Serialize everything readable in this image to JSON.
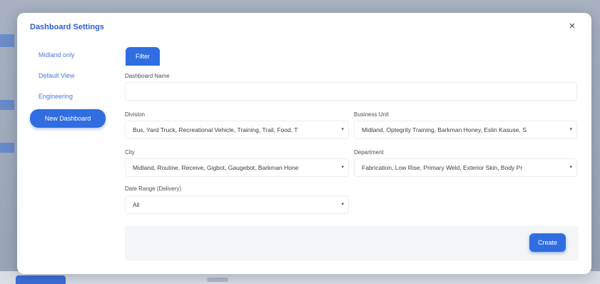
{
  "modal": {
    "title": "Dashboard Settings",
    "close_glyph": "×"
  },
  "sidebar": {
    "items": [
      {
        "label": "Midland only"
      },
      {
        "label": "Default View"
      },
      {
        "label": "Engineering"
      },
      {
        "label": "New Dashboard",
        "active": true
      }
    ]
  },
  "tabs": {
    "filter_label": "Filter"
  },
  "form": {
    "dashboard_name": {
      "label": "Dashboard Name",
      "value": ""
    },
    "division": {
      "label": "Division",
      "value": "Bus, Yard Truck, Recreational Vehicle, Training, Trail, Food, T"
    },
    "business_unit": {
      "label": "Business Unit",
      "value": "Midland, Optegrity Training, Barkman Honey, Eslin Kasuse, S"
    },
    "city": {
      "label": "City",
      "value": "Midland, Routine, Receive, Gigbot, Gaugebot, Barkman Hone"
    },
    "department": {
      "label": "Department",
      "value": "Fabrication, Low Rise, Primary Weld, Exterior Skin, Body Pr"
    },
    "date_range": {
      "label": "Date Range (Delivery)",
      "value": "All"
    }
  },
  "footer": {
    "create_label": "Create"
  },
  "icons": {
    "close": "close-icon",
    "caret": "chevron-down-icon"
  },
  "colors": {
    "accent": "#2f6de1",
    "title": "#2f5fd0",
    "link": "#4a78d8"
  }
}
